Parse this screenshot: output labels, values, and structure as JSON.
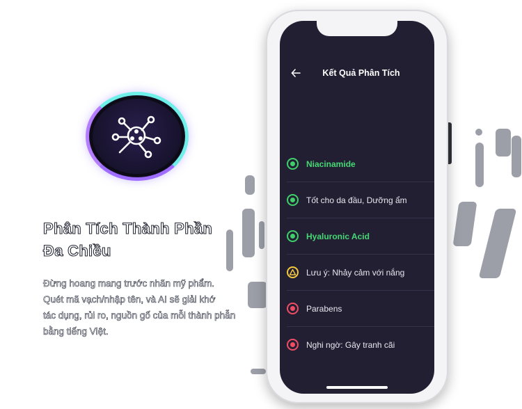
{
  "feature": {
    "icon": "molecule-search-icon",
    "title_line1": "Phân Tích Thành Phần",
    "title_line2": "Đa Chiều",
    "desc_lines": [
      "Đừng hoang mang trước nhãn mỹ phẩm.",
      "Quét mã vạch/nhập tên, và AI sẽ giải khớ",
      "tác dụng, rủi ro, nguồn gố của mỗi thành phẫn",
      "bằng tiếng Việt."
    ]
  },
  "screen": {
    "back_icon": "arrow-left-icon",
    "title": "Kết Quả Phân Tích",
    "items": [
      {
        "label": "Niacinamide",
        "status": "good",
        "highlight": true
      },
      {
        "label": "Tốt cho da đầu, Dưỡng ẩm",
        "status": "good",
        "highlight": false
      },
      {
        "label": "Hyaluronic Acid",
        "status": "good",
        "highlight": true
      },
      {
        "label": "Lưu ý: Nhảy cảm với nắng",
        "status": "warning",
        "highlight": false
      },
      {
        "label": "Parabens",
        "status": "bad",
        "highlight": false
      },
      {
        "label": "Nghi ngờ: Gây tranh cãi",
        "status": "bad",
        "highlight": false
      }
    ]
  },
  "colors": {
    "screen_bg": "#231f33",
    "good": "#3fd06a",
    "warning": "#f3c93e",
    "bad": "#ef4d63"
  }
}
